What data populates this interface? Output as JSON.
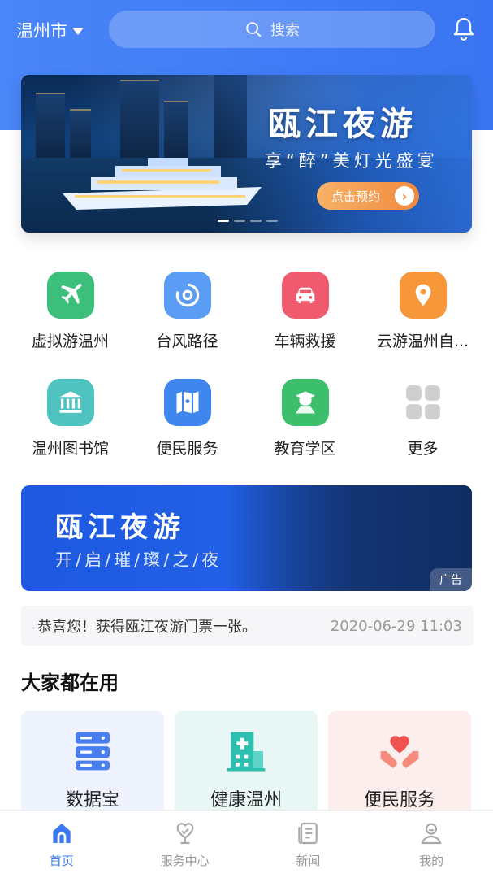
{
  "header": {
    "city": "温州市",
    "search_placeholder": "搜索"
  },
  "banner": {
    "title": "瓯江夜游",
    "subtitle": "享“醉”美灯光盛宴",
    "button_label": "点击预约",
    "dots": 4,
    "active_dot": 0
  },
  "grid": [
    {
      "label": "虚拟游温州",
      "icon": "airplane-icon",
      "color": "#3bbf7a"
    },
    {
      "label": "台风路径",
      "icon": "typhoon-icon",
      "color": "#5b9cf5"
    },
    {
      "label": "车辆救援",
      "icon": "car-icon",
      "color": "#ef5a6f"
    },
    {
      "label": "云游温州自...",
      "icon": "location-pin-icon",
      "color": "#f7973a"
    },
    {
      "label": "温州图书馆",
      "icon": "library-icon",
      "color": "#4fc3c0"
    },
    {
      "label": "便民服务",
      "icon": "map-icon",
      "color": "#3f86ee"
    },
    {
      "label": "教育学区",
      "icon": "education-icon",
      "color": "#3bbf6a"
    },
    {
      "label": "更多",
      "icon": "more-grid-icon",
      "color": "#cfcfcf"
    }
  ],
  "ad": {
    "title": "瓯江夜游",
    "subtitle": "开/启/璀/璨/之/夜",
    "badge": "广告"
  },
  "notice": {
    "message": "恭喜您！获得瓯江夜游门票一张。",
    "time": "2020-06-29 11:03"
  },
  "section": {
    "title": "大家都在用"
  },
  "cards": [
    {
      "label": "数据宝",
      "icon": "database-icon",
      "bg": "#eef3fd",
      "color": "#4a7ef0"
    },
    {
      "label": "健康温州",
      "icon": "hospital-icon",
      "bg": "#e8f7f5",
      "color": "#2fbfae"
    },
    {
      "label": "便民服务",
      "icon": "heart-hands-icon",
      "bg": "#fdeeee",
      "color": "#f0524f"
    }
  ],
  "tabbar": [
    {
      "label": "首页",
      "icon": "home-icon",
      "active": true
    },
    {
      "label": "服务中心",
      "icon": "service-heart-icon",
      "active": false
    },
    {
      "label": "新闻",
      "icon": "news-icon",
      "active": false
    },
    {
      "label": "我的",
      "icon": "profile-icon",
      "active": false
    }
  ],
  "colors": {
    "primary": "#3b78f2",
    "header_bg": "#4a86f7"
  }
}
